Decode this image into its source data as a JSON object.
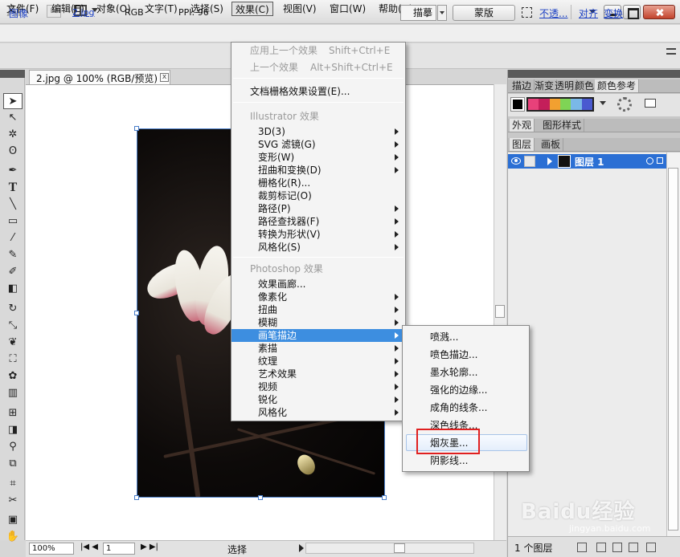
{
  "app": {
    "logo": "Ai",
    "bridge_label": "Br"
  },
  "menubar": {
    "items": [
      {
        "label": "文件(F)"
      },
      {
        "label": "编辑(E)"
      },
      {
        "label": "对象(O)"
      },
      {
        "label": "文字(T)"
      },
      {
        "label": "选择(S)"
      },
      {
        "label": "效果(C)"
      },
      {
        "label": "视图(V)"
      },
      {
        "label": "窗口(W)"
      },
      {
        "label": "帮助(H)"
      }
    ]
  },
  "controlbar": {
    "object_type": "图像",
    "file_link": "2.jpg",
    "color_mode": "RGB",
    "ppi": "PPI: 96",
    "trace_label": "描摹",
    "mask_label": "蒙版",
    "opacity_link": "不透...",
    "align_link": "对齐",
    "transform_link": "变换"
  },
  "document": {
    "tab_title": "2.jpg @ 100% (RGB/预览)",
    "close_glyph": "x"
  },
  "statusbar": {
    "zoom": "100%",
    "artboard": "1",
    "mode": "选择"
  },
  "effects_menu": {
    "apply_last": {
      "label": "应用上一个效果",
      "shortcut": "Shift+Ctrl+E"
    },
    "last_effect": {
      "label": "上一个效果",
      "shortcut": "Alt+Shift+Ctrl+E"
    },
    "raster_settings": "文档栅格效果设置(E)...",
    "illustrator_section": "Illustrator 效果",
    "illustrator_items": [
      {
        "label": "3D(3)"
      },
      {
        "label": "SVG 滤镜(G)"
      },
      {
        "label": "变形(W)"
      },
      {
        "label": "扭曲和变换(D)"
      },
      {
        "label": "栅格化(R)..."
      },
      {
        "label": "裁剪标记(O)"
      },
      {
        "label": "路径(P)"
      },
      {
        "label": "路径查找器(F)"
      },
      {
        "label": "转换为形状(V)"
      },
      {
        "label": "风格化(S)"
      }
    ],
    "photoshop_section": "Photoshop 效果",
    "photoshop_items": [
      {
        "label": "效果画廊..."
      },
      {
        "label": "像素化"
      },
      {
        "label": "扭曲"
      },
      {
        "label": "模糊"
      },
      {
        "label": "画笔描边"
      },
      {
        "label": "素描"
      },
      {
        "label": "纹理"
      },
      {
        "label": "艺术效果"
      },
      {
        "label": "视频"
      },
      {
        "label": "锐化"
      },
      {
        "label": "风格化"
      }
    ]
  },
  "brush_strokes_submenu": {
    "items": [
      {
        "label": "喷溅..."
      },
      {
        "label": "喷色描边..."
      },
      {
        "label": "墨水轮廓..."
      },
      {
        "label": "强化的边缘..."
      },
      {
        "label": "成角的线条..."
      },
      {
        "label": "深色线条..."
      },
      {
        "label": "烟灰墨..."
      },
      {
        "label": "阴影线..."
      }
    ]
  },
  "panels": {
    "top_tabs": [
      "描边",
      "渐变",
      "透明",
      "颜色",
      "颜色参考"
    ],
    "appearance_tabs": [
      "外观",
      "图形样式"
    ],
    "layers_tabs": [
      "图层",
      "画板"
    ],
    "layer_name": "图层 1",
    "layer_count": "1 个图层",
    "color_group": [
      "#e8417a",
      "#c41f5a",
      "#f2a030",
      "#7fd455",
      "#7ab8e8",
      "#4a5ad0"
    ],
    "accent": "#2b6fd4"
  },
  "watermark": {
    "main": "Baidu经验",
    "sub": "jingyan.baidu.com"
  }
}
